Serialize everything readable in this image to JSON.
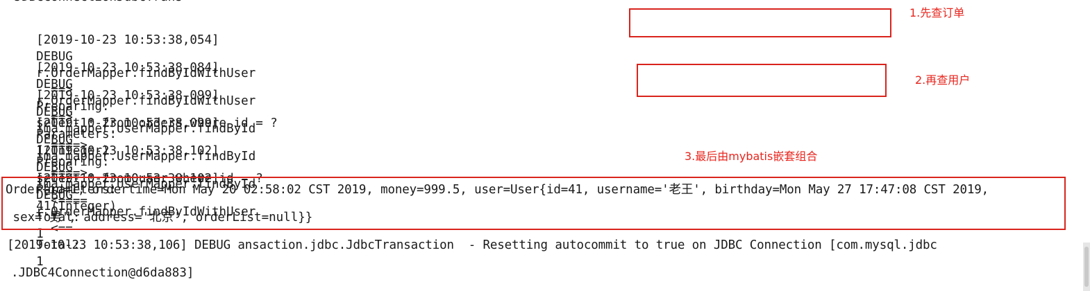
{
  "log": {
    "cut_top_line": "•ЈDBCConnectionJdbcTrans",
    "lines": [
      {
        "time": "[2019-10-23 10:53:38,054]",
        "level": "DEBUG",
        "logger": "r.OrderMapper.findByIdWithUser",
        "arrow": "- ==>",
        "label": "Preparing:",
        "value": "select * from orders where id = ?"
      },
      {
        "time": "[2019-10-23 10:53:38,084]",
        "level": "DEBUG",
        "logger": "r.OrderMapper.findByIdWithUser",
        "arrow": "- ==>",
        "label": "Parameters:",
        "value": "1(Integer)"
      },
      {
        "time": "[2019-10-23 10:53:38,099]",
        "level": "DEBUG",
        "logger": "ima.mapper.UserMapper.findById",
        "arrow": "- ====>",
        "label": "Preparing:",
        "value": "select * from user where id = ?"
      },
      {
        "time": "[2019-10-23 10:53:38,099]",
        "level": "DEBUG",
        "logger": "ima.mapper.UserMapper.findById",
        "arrow": "- ====>",
        "label": "Parameters:",
        "value": "41(Integer)"
      },
      {
        "time": "[2019-10-23 10:53:38,102]",
        "level": "DEBUG",
        "logger": "ima.mapper.UserMapper.findById",
        "arrow": "- <====",
        "label": "Total:",
        "value": "1"
      },
      {
        "time": "[2019-10-23 10:53:38,102]",
        "level": "DEBUG",
        "logger": "r.OrderMapper.findByIdWithUser",
        "arrow": "- <==",
        "label": "Total:",
        "value": "1"
      }
    ],
    "result_line_1": "Order{id=1, ordertime=Mon May 20 02:58:02 CST 2019, money=999.5, user=User{id=41, username='老王', birthday=Mon May 27 17:47:08 CST 2019,",
    "result_line_2": " sex='男', address='北京', orderList=null}}",
    "tx_line_1": "[2019-10-23 10:53:38,106] DEBUG ansaction.jdbc.JdbcTransaction  - Resetting autocommit to true on JDBC Connection [com.mysql.jdbc",
    "tx_line_2": ".JDBC4Connection@d6da883]"
  },
  "annotations": {
    "note_1": "1.先查订单",
    "note_2": "2.再查用户",
    "note_3": "3.最后由mybatis嵌套组合",
    "box_color": "#d9231c",
    "text_color": "#e8251d"
  }
}
